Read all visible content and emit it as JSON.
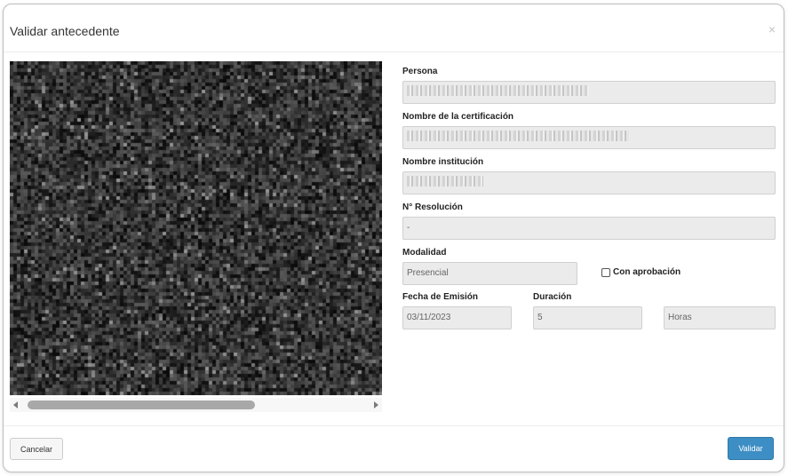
{
  "modal": {
    "title": "Validar antecedente",
    "close_label": "×"
  },
  "form": {
    "persona": {
      "label": "Persona",
      "value": ""
    },
    "certificacion": {
      "label": "Nombre de la certificación",
      "value": ""
    },
    "institucion": {
      "label": "Nombre institución",
      "value": ""
    },
    "resolucion": {
      "label": "N° Resolución",
      "value": "-"
    },
    "modalidad": {
      "label": "Modalidad",
      "value": "Presencial"
    },
    "con_aprobacion": {
      "label": "Con aprobación",
      "checked": false
    },
    "fecha_emision": {
      "label": "Fecha de Emisión",
      "value": "03/11/2023"
    },
    "duracion": {
      "label": "Duración",
      "value": "5",
      "unit": "Horas"
    }
  },
  "footer": {
    "cancel_label": "Cancelar",
    "validate_label": "Validar"
  },
  "colors": {
    "primary": "#3d8ec4",
    "field_bg": "#ebebeb"
  }
}
